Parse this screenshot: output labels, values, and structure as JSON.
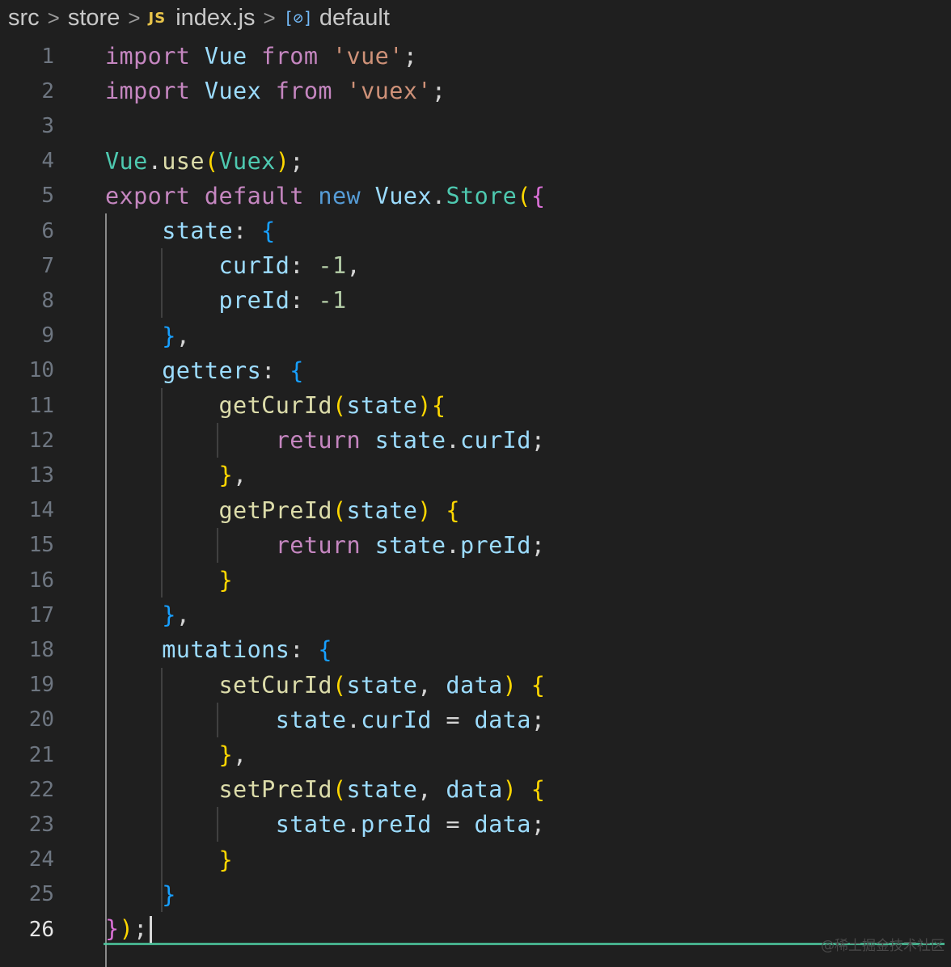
{
  "breadcrumb": {
    "items": [
      "src",
      "store",
      "index.js",
      "default"
    ],
    "file_badge": "JS",
    "symbol_icon": "[⊘]"
  },
  "editor": {
    "active_line": 26,
    "lines": [
      {
        "n": "1"
      },
      {
        "n": "2"
      },
      {
        "n": "3"
      },
      {
        "n": "4"
      },
      {
        "n": "5"
      },
      {
        "n": "6"
      },
      {
        "n": "7"
      },
      {
        "n": "8"
      },
      {
        "n": "9"
      },
      {
        "n": "10"
      },
      {
        "n": "11"
      },
      {
        "n": "12"
      },
      {
        "n": "13"
      },
      {
        "n": "14"
      },
      {
        "n": "15"
      },
      {
        "n": "16"
      },
      {
        "n": "17"
      },
      {
        "n": "18"
      },
      {
        "n": "19"
      },
      {
        "n": "20"
      },
      {
        "n": "21"
      },
      {
        "n": "22"
      },
      {
        "n": "23"
      },
      {
        "n": "24"
      },
      {
        "n": "25"
      },
      {
        "n": "26"
      }
    ],
    "tokens": {
      "import": "import",
      "from": "from",
      "vue_ident": "Vue",
      "vuex_ident": "Vuex",
      "vue_str": "'vue'",
      "vuex_str": "'vuex'",
      "semi": ";",
      "use": "use",
      "export": "export",
      "default": "default",
      "new": "new",
      "store": "Store",
      "state": "state",
      "getters": "getters",
      "mutations": "mutations",
      "curId": "curId",
      "preId": "preId",
      "neg_one": "-1",
      "getCurId": "getCurId",
      "getPreId": "getPreId",
      "setCurId": "setCurId",
      "setPreId": "setPreId",
      "return": "return",
      "data": "data"
    }
  },
  "watermark": "@稀土掘金技术社区",
  "colors": {
    "background": "#1f1f1f",
    "keyword": "#c586c0",
    "variable": "#9cdcfe",
    "string": "#ce9178",
    "type": "#4ec9b0",
    "function": "#dcdcaa",
    "number": "#b5cea8"
  }
}
